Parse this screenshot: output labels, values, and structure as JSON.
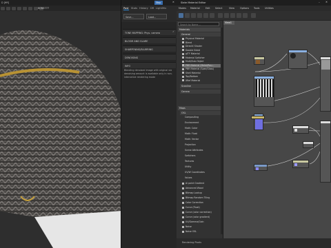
{
  "viewport": {
    "title": "D [ffff]",
    "toolbar_label": "BONE777"
  },
  "render_settings": {
    "tabs": [
      "Post",
      "Stats",
      "History",
      "DR",
      "LightMix"
    ],
    "active_tab": "Post",
    "stop_label": "Stop",
    "save_label": "Save...",
    "load_label": "Load...",
    "sections": [
      "TONE MAPPING: Phys. camera",
      "BLOOM AND GLARE",
      "SHARPENING/BLURRING",
      "DENOISING"
    ],
    "info_header": "INFO",
    "info_text": "Blending denoised image with original via denoising amount is available only in non-interactive rendering mode"
  },
  "slate": {
    "title": "Slate Material Editor",
    "menu": [
      "Modes",
      "Material",
      "Edit",
      "Select",
      "View",
      "Options",
      "Tools",
      "Utilities"
    ],
    "search_placeholder": "Search by Name ...",
    "view_tab": "View1",
    "materials_header": "Materials",
    "general_header": "General",
    "materials": [
      "Physical Material",
      "Blend",
      "DirectX Shader",
      "Double Sided",
      "glTF Material",
      "Material Switcher",
      "Multi/Sub-Object",
      "PBR Material (Metal/Rou...",
      "PBR Material (Spec/Gloss)",
      "Shell Material",
      "Top/Bottom",
      "XRef Material"
    ],
    "scanline_header": "Scanline",
    "corona_header": "Corona",
    "maps_header": "Maps",
    "osl_header": "OSL",
    "osl_items": [
      "Compositing",
      "Environment",
      "Math: Color",
      "Math: Float",
      "Math: Vector",
      "Projection",
      "Scene Attributes",
      "Switchers",
      "Textures",
      "Utility",
      "UV/W Coordinates",
      "Values"
    ],
    "general_maps": [
      "Ai point Gradient",
      "Advanced Wood",
      "Bitmap Lookup",
      "Bitmap Random Tiling",
      "Color Correction",
      "Curve (Float)",
      "Curve (color correction)",
      "Curve (color gradient)",
      "UV/Gamma/Gain",
      "Noise",
      "Noise OSL"
    ],
    "status": "Rendering Pixels"
  }
}
